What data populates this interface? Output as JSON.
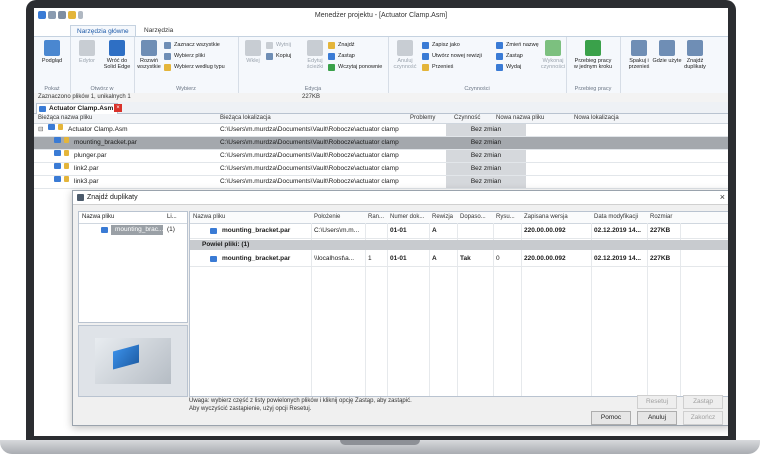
{
  "window": {
    "title": "Menedżer projektu - [Actuator Clamp.Asm]"
  },
  "tabs": [
    {
      "label": "Narzędzia główne"
    },
    {
      "label": "Narzędzia"
    }
  ],
  "ribbon": {
    "group_podglad": {
      "label": "Pokaż",
      "btn": "Podgląd"
    },
    "group_otworz": {
      "label": "Otwórz w",
      "edytor": "Edytor",
      "wroc": "Wróć do Solid Edge"
    },
    "group_wybierz": {
      "label": "Wybierz",
      "rozwin": "Rozwiń wszystkie",
      "zaznacz": "Zaznacz wszystkie",
      "wybierz_pliki": "Wybierz pliki",
      "wybierz_typ": "Wybierz według typu"
    },
    "group_edycja": {
      "label": "Edycja",
      "wklej": "Wklej",
      "wytnij": "Wytnij",
      "kopiuj": "Kopiuj",
      "edytuj": "Edytuj ścieżki",
      "znajdz": "Znajdź",
      "zastap": "Zastąp",
      "wczytaj": "Wczytaj ponownie"
    },
    "group_czynnosci": {
      "label": "Czynności",
      "anuluj": "Anuluj czynność",
      "zapisz_jako": "Zapisz jako",
      "utworz": "Utwórz nowej rewizji",
      "przenies": "Przenieś",
      "zmien": "Zmień nazwę",
      "zastap": "Zastąp",
      "wydaj": "Wydaj",
      "wykonaj": "Wykonaj czynności"
    },
    "group_przebieg": {
      "label": "Przebieg pracy",
      "btn": "Przebieg pracy w jednym kroku"
    },
    "group_extra": {
      "spakuj": "Spakuj i przenieś",
      "gdzie": "Gdzie użyte",
      "znajdz_dup": "Znajdź duplikaty"
    }
  },
  "status": {
    "selection": "Zaznaczono plików 1, unikalnych 1",
    "size": "227KB"
  },
  "doc_tab": {
    "label": "Actuator Clamp.Asm",
    "close": "×"
  },
  "grid": {
    "headers": [
      "Bieżąca nazwa pliku",
      "Bieżąca lokalizacja",
      "Problemy",
      "Czynność",
      "Nowa nazwa pliku",
      "Nowa lokalizacja"
    ],
    "rows": [
      {
        "name": "Actuator Clamp.Asm",
        "loc": "C:\\Users\\m.murdza\\Documents\\Vault\\Robocze\\actuator clamp",
        "action": "Bez zmian"
      },
      {
        "name": "mounting_bracket.par",
        "loc": "C:\\Users\\m.murdza\\Documents\\Vault\\Robocze\\actuator clamp",
        "action": "Bez zmian"
      },
      {
        "name": "plunger.par",
        "loc": "C:\\Users\\m.murdza\\Documents\\Vault\\Robocze\\actuator clamp",
        "action": "Bez zmian"
      },
      {
        "name": "link2.par",
        "loc": "C:\\Users\\m.murdza\\Documents\\Vault\\Robocze\\actuator clamp",
        "action": "Bez zmian"
      },
      {
        "name": "link3.par",
        "loc": "C:\\Users\\m.murdza\\Documents\\Vault\\Robocze\\actuator clamp",
        "action": "Bez zmian"
      }
    ]
  },
  "dialog": {
    "title": "Znajdź duplikaty",
    "left_headers": [
      "Nazwa pliku",
      "Li..."
    ],
    "left_row": {
      "name": "mounting_brac...",
      "count": "(1)"
    },
    "right_headers": [
      "Nazwa pliku",
      "Położenie",
      "Ran...",
      "Numer dok...",
      "Rewizja",
      "Dopaso...",
      "Rysu...",
      "Zapisana wersja",
      "Data modyfikacji",
      "Rozmiar"
    ],
    "row1": {
      "name": "mounting_bracket.par",
      "loc": "C:\\Users\\m.m...",
      "ran": "",
      "doc": "01-01",
      "rev": "A",
      "match": "",
      "rys": "",
      "ver": "220.00.00.092",
      "date": "02.12.2019 14...",
      "size": "227KB"
    },
    "separator": "Powiel pliki: (1)",
    "row2": {
      "name": "mounting_bracket.par",
      "loc": "\\\\localhost\\a...",
      "ran": "1",
      "doc": "01-01",
      "rev": "A",
      "match": "Tak",
      "rys": "0",
      "ver": "220.00.00.092",
      "date": "02.12.2019 14...",
      "size": "227KB"
    },
    "notice_line1": "Uwaga: wybierz część z listy powielonych plików i kliknij opcję Zastąp, aby zastąpić.",
    "notice_line2": "Aby wyczyścić zastąpienie, użyj opcji Resetuj.",
    "btn_resetuj": "Resetuj",
    "btn_zastap": "Zastąp",
    "btn_pomoc": "Pomoc",
    "btn_anuluj": "Anuluj",
    "btn_zakoncz": "Zakończ"
  }
}
